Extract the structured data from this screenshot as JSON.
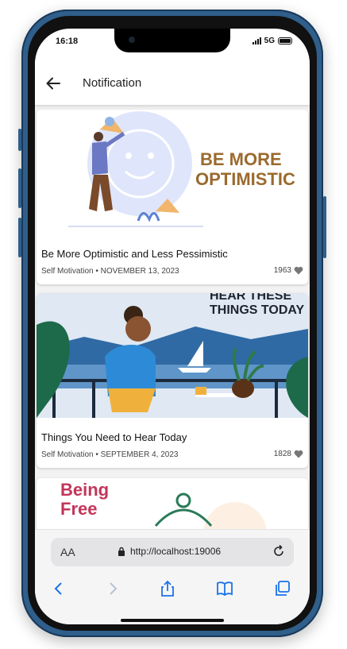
{
  "status": {
    "time": "16:18",
    "network": "5G"
  },
  "appbar": {
    "title": "Notification"
  },
  "posts": [
    {
      "title": "Be More Optimistic and Less Pessimistic",
      "category": "Self Motivation",
      "date": "NOVEMBER 13, 2023",
      "meta": "Self Motivation • NOVEMBER 13, 2023",
      "likes": "1963",
      "image_text": [
        "BE MORE",
        "OPTIMISTIC"
      ]
    },
    {
      "title": "Things You Need to Hear Today",
      "category": "Self Motivation",
      "date": "SEPTEMBER 4, 2023",
      "meta": "Self Motivation • SEPTEMBER 4, 2023",
      "likes": "1828",
      "image_text": [
        "HEAR THESE",
        "THINGS TODAY"
      ]
    },
    {
      "title": "",
      "image_text": [
        "Being",
        "Free"
      ]
    }
  ],
  "browser": {
    "url": "http://localhost:19006",
    "aa_label": "AA"
  },
  "colors": {
    "frame": "#2f5f8a",
    "accent": "#1a73e8",
    "heart": "#777777",
    "optimistic_text": "#9b6a2e",
    "being_free_text": "#c2365a"
  },
  "icons": [
    "back-arrow-icon",
    "heart-icon",
    "lock-icon",
    "reload-icon",
    "chevron-left-icon",
    "chevron-right-icon",
    "share-icon",
    "book-icon",
    "tabs-icon"
  ]
}
